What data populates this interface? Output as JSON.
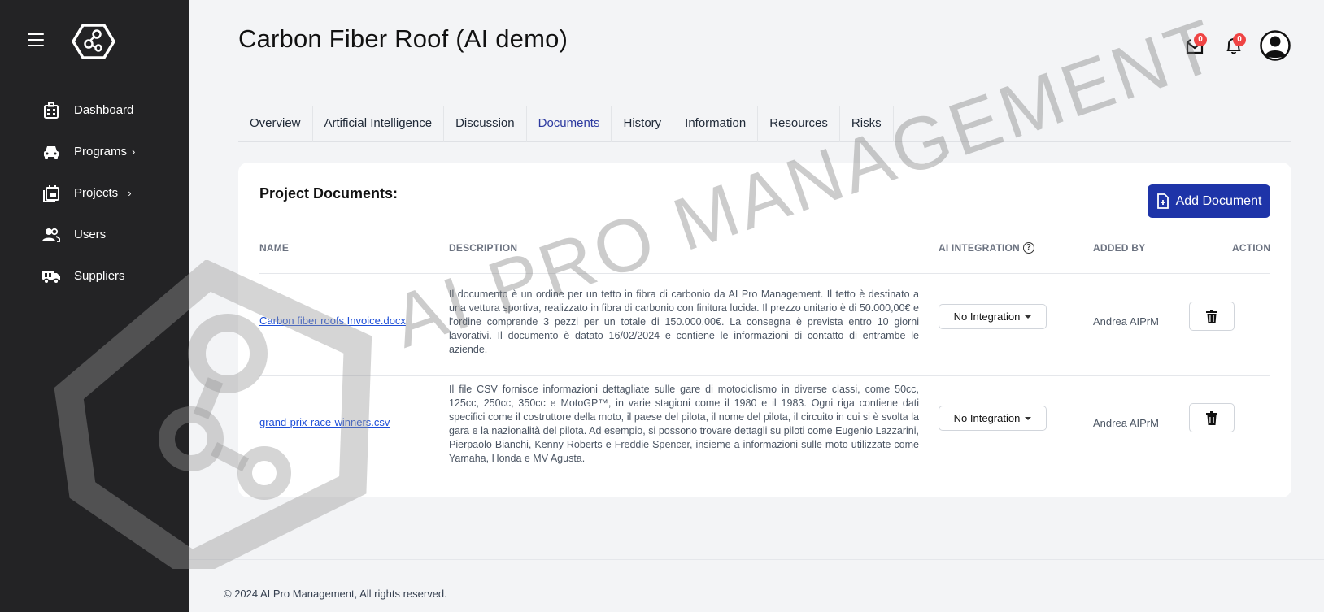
{
  "sidebar": {
    "items": [
      {
        "label": "Dashboard",
        "icon": "building-icon"
      },
      {
        "label": "Programs",
        "icon": "car-icon",
        "chevron": "›"
      },
      {
        "label": "Projects",
        "icon": "projects-icon",
        "chevron": "›"
      },
      {
        "label": "Users",
        "icon": "users-icon"
      },
      {
        "label": "Suppliers",
        "icon": "truck-icon"
      }
    ]
  },
  "header": {
    "title": "Carbon Fiber Roof (AI demo)",
    "mail_count": "0",
    "notif_count": "0"
  },
  "tabs": [
    {
      "label": "Overview"
    },
    {
      "label": "Artificial Intelligence"
    },
    {
      "label": "Discussion"
    },
    {
      "label": "Documents",
      "active": true
    },
    {
      "label": "History"
    },
    {
      "label": "Information"
    },
    {
      "label": "Resources"
    },
    {
      "label": "Risks"
    }
  ],
  "documents": {
    "title": "Project Documents:",
    "add_label": "Add Document",
    "columns": {
      "name": "NAME",
      "description": "DESCRIPTION",
      "ai_integration": "AI INTEGRATION",
      "added_by": "ADDED BY",
      "action": "ACTION"
    },
    "rows": [
      {
        "name": "Carbon fiber roofs Invoice.docx",
        "description": "Il documento è un ordine per un tetto in fibra di carbonio da AI Pro Management. Il tetto è destinato a una vettura sportiva, realizzato in fibra di carbonio con finitura lucida. Il prezzo unitario è di 50.000,00€ e l'ordine comprende 3 pezzi per un totale di 150.000,00€. La consegna è prevista entro 10 giorni lavorativi. Il documento è datato 16/02/2024 e contiene le informazioni di contatto di entrambe le aziende.",
        "integration": "No Integration",
        "added_by": "Andrea AIPrM"
      },
      {
        "name": "grand-prix-race-winners.csv",
        "description": "Il file CSV fornisce informazioni dettagliate sulle gare di motociclismo in diverse classi, come 50cc, 125cc, 250cc, 350cc e MotoGP™, in varie stagioni come il 1980 e il 1983. Ogni riga contiene dati specifici come il costruttore della moto, il paese del pilota, il nome del pilota, il circuito in cui si è svolta la gara e la nazionalità del pilota. Ad esempio, si possono trovare dettagli su piloti come Eugenio Lazzarini, Pierpaolo Bianchi, Kenny Roberts e Freddie Spencer, insieme a informazioni sulle moto utilizzate come Yamaha, Honda e MV Agusta.",
        "integration": "No Integration",
        "added_by": "Andrea AIPrM"
      }
    ]
  },
  "footer": "© 2024 AI Pro Management, All rights reserved.",
  "watermark": "AI PRO MANAGEMENT",
  "colors": {
    "sidebar": "#232325",
    "primary": "#1e34a8",
    "active_tab": "#2d3aa0",
    "badge": "#ef4444",
    "link": "#1d4ed8"
  }
}
